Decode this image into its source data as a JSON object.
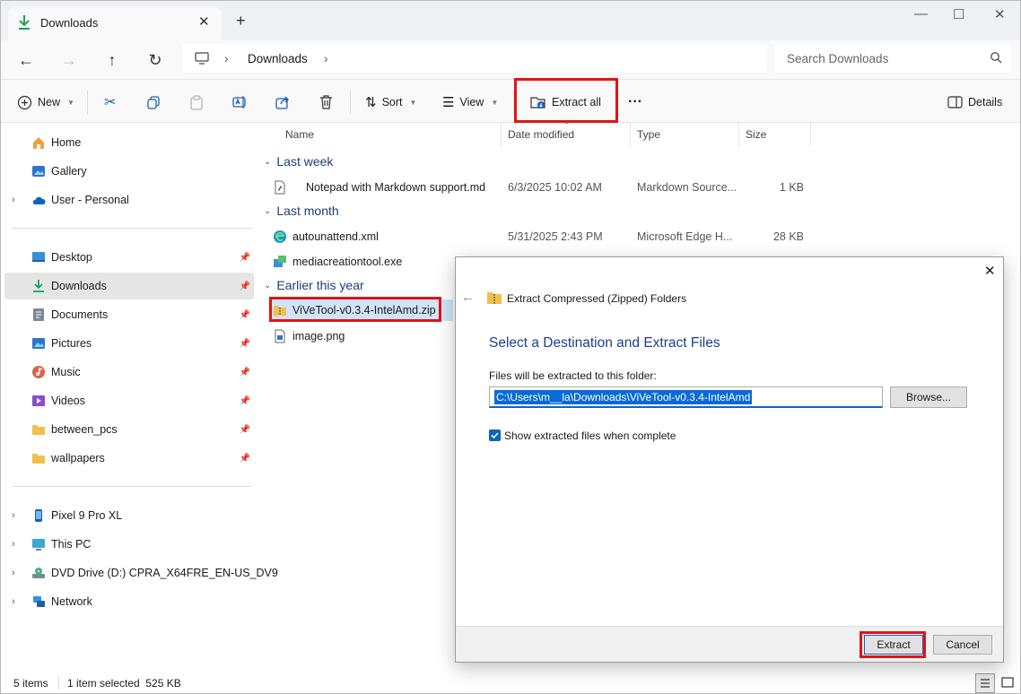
{
  "window": {
    "tab_title": "Downloads",
    "tab_close": "✕",
    "new_tab": "+",
    "minimize": "—",
    "maximize": "☐",
    "close": "✕"
  },
  "address": {
    "crumb_root_sep": "›",
    "crumb": "Downloads",
    "crumb_sep": "›",
    "search_placeholder": "Search Downloads"
  },
  "toolbar": {
    "new_label": "New",
    "sort_label": "Sort",
    "view_label": "View",
    "extract_all_label": "Extract all",
    "more_label": "···",
    "details_label": "Details"
  },
  "sidebar": {
    "top": [
      {
        "label": "Home",
        "icon": "home-icon"
      },
      {
        "label": "Gallery",
        "icon": "gallery-icon"
      },
      {
        "label": "User - Personal",
        "icon": "cloud-icon",
        "chevron": "›"
      }
    ],
    "quick": [
      {
        "label": "Desktop",
        "icon": "desktop-icon"
      },
      {
        "label": "Downloads",
        "icon": "download-icon",
        "selected": true
      },
      {
        "label": "Documents",
        "icon": "documents-icon"
      },
      {
        "label": "Pictures",
        "icon": "pictures-icon"
      },
      {
        "label": "Music",
        "icon": "music-icon"
      },
      {
        "label": "Videos",
        "icon": "videos-icon"
      },
      {
        "label": "between_pcs",
        "icon": "folder-icon"
      },
      {
        "label": "wallpapers",
        "icon": "folder-icon"
      }
    ],
    "devices": [
      {
        "label": "Pixel 9 Pro XL",
        "icon": "phone-icon"
      },
      {
        "label": "This PC",
        "icon": "pc-icon"
      },
      {
        "label": "DVD Drive (D:) CPRA_X64FRE_EN-US_DV9",
        "icon": "dvd-icon"
      },
      {
        "label": "Network",
        "icon": "network-icon"
      }
    ],
    "pin_glyph": "📌",
    "chevron": "›"
  },
  "columns": {
    "name": "Name",
    "date": "Date modified",
    "type": "Type",
    "size": "Size",
    "sort_arrow": "⌃"
  },
  "groups": {
    "last_week": "Last week",
    "last_month": "Last month",
    "earlier": "Earlier this year",
    "chevron": "⌄"
  },
  "files": [
    {
      "name": "Notepad with Markdown support.md",
      "date": "6/3/2025 10:02 AM",
      "type": "Markdown Source...",
      "size": "1 KB"
    },
    {
      "name": "autounattend.xml",
      "date": "5/31/2025 2:43 PM",
      "type": "Microsoft Edge H...",
      "size": "28 KB"
    },
    {
      "name": "mediacreationtool.exe",
      "date": "",
      "type": "",
      "size": ""
    },
    {
      "name": "ViVeTool-v0.3.4-IntelAmd.zip",
      "date": "",
      "type": "",
      "size": ""
    },
    {
      "name": "image.png",
      "date": "",
      "type": "",
      "size": ""
    }
  ],
  "status": {
    "items": "5 items",
    "selected": "1 item selected  525 KB"
  },
  "dialog": {
    "close": "✕",
    "back": "←",
    "title": "Extract Compressed (Zipped) Folders",
    "heading": "Select a Destination and Extract Files",
    "folder_label": "Files will be extracted to this folder:",
    "path_value": "C:\\Users\\m__la\\Downloads\\ViVeTool-v0.3.4-IntelAmd",
    "browse_label": "Browse...",
    "checkbox_label": "Show extracted files when complete",
    "checkbox_checked": true,
    "extract_label": "Extract",
    "cancel_label": "Cancel"
  },
  "colors": {
    "accent": "#0a64c2",
    "highlight_box": "#e01414",
    "group_header": "#1c3d7a"
  }
}
